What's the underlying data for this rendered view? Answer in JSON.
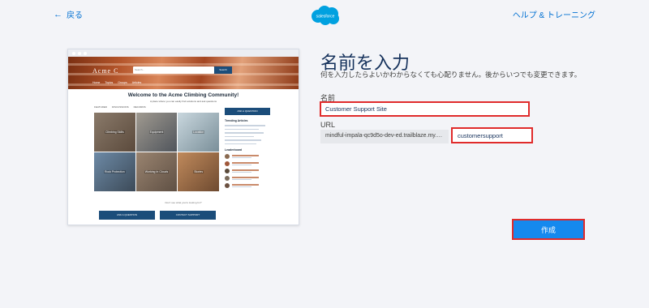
{
  "nav": {
    "back_label": "戻る",
    "help_label": "ヘルプ & トレーニング",
    "logo_text": "salesforce"
  },
  "form": {
    "title": "名前を入力",
    "subtitle": "何を入力したらよいかわからなくても心配りません。後からいつでも変更できます。",
    "name_label": "名前",
    "name_value": "Customer Support Site",
    "url_label": "URL",
    "url_prefix": "mindful-impala-qc9d5o-dev-ed.trailblaze.my.sit...",
    "url_value": "customersupport",
    "create_label": "作成"
  },
  "preview": {
    "brand": "Acme C",
    "search_placeholder": "Search...",
    "search_button": "Search",
    "nav_items": [
      "Home",
      "Topics",
      "Groups",
      "Articles"
    ],
    "welcome": "Welcome to the Acme Climbing Community!",
    "welcome_sub": "A place where you can easily find solutions and ask questions",
    "tabs": [
      "FEATURED",
      "DISCUSSIONS",
      "RECORDS"
    ],
    "tiles": [
      "Climbing Skills",
      "Equipment",
      "Location",
      "Rock Protection",
      "Working In Clouds",
      "Stories"
    ],
    "ask_button": "ASK A QUESTION",
    "trending_title": "Trending Articles",
    "leaderboard_title": "Leaderboard",
    "footer_question": "Don't see what you're looking for?",
    "footer_btn_1": "ASK A QUESTION",
    "footer_btn_2": "CONTACT SUPPORT"
  },
  "colors": {
    "brand_blue": "#1589ee",
    "highlight_red": "#e02b2b",
    "preview_navy": "#1b4d7a"
  }
}
